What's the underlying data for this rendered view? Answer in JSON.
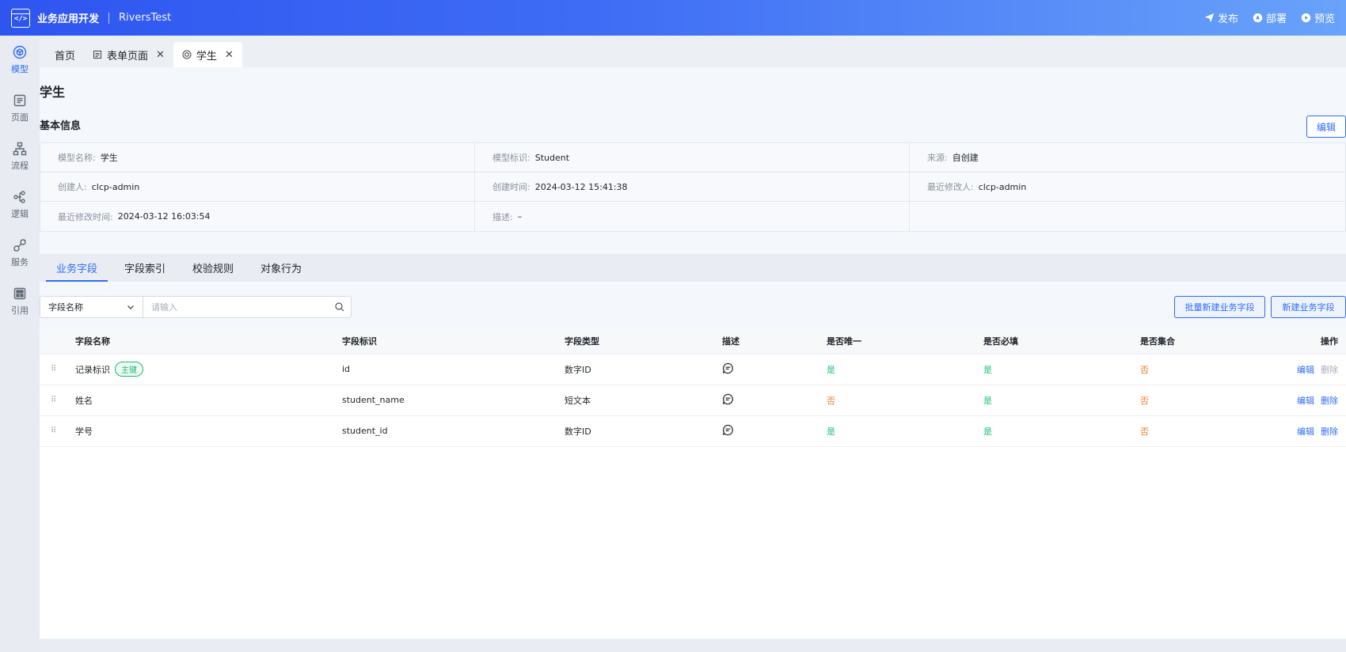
{
  "header": {
    "app_name": "业务应用开发",
    "project_name": "RiversTest",
    "actions": [
      {
        "label": "发布",
        "icon": "send-icon"
      },
      {
        "label": "部署",
        "icon": "deploy-icon"
      },
      {
        "label": "预览",
        "icon": "play-icon"
      }
    ]
  },
  "rail": [
    {
      "label": "模型",
      "icon": "model-icon",
      "active": true
    },
    {
      "label": "页面",
      "icon": "page-icon",
      "active": false
    },
    {
      "label": "流程",
      "icon": "flow-icon",
      "active": false
    },
    {
      "label": "逻辑",
      "icon": "logic-icon",
      "active": false
    },
    {
      "label": "服务",
      "icon": "service-icon",
      "active": false
    },
    {
      "label": "引用",
      "icon": "reference-icon",
      "active": false
    }
  ],
  "tabs": [
    {
      "label": "首页",
      "closable": false,
      "active": false
    },
    {
      "label": "表单页面",
      "closable": true,
      "active": false
    },
    {
      "label": "学生",
      "closable": true,
      "active": true
    }
  ],
  "page": {
    "title": "学生",
    "section_title": "基本信息",
    "edit_label": "编辑"
  },
  "info": [
    {
      "key": "模型名称:",
      "value": "学生"
    },
    {
      "key": "模型标识:",
      "value": "Student"
    },
    {
      "key": "来源:",
      "value": "自创建"
    },
    {
      "key": "创建人:",
      "value": "clcp-admin"
    },
    {
      "key": "创建时间:",
      "value": "2024-03-12 15:41:38"
    },
    {
      "key": "最近修改人:",
      "value": "clcp-admin"
    },
    {
      "key": "最近修改时间:",
      "value": "2024-03-12 16:03:54"
    },
    {
      "key": "描述:",
      "value": "–"
    },
    {
      "key": "",
      "value": ""
    }
  ],
  "subtabs": [
    "业务字段",
    "字段索引",
    "校验规则",
    "对象行为"
  ],
  "filter": {
    "select_value": "字段名称",
    "placeholder": "请输入"
  },
  "buttons": {
    "batch_new": "批量新建业务字段",
    "new": "新建业务字段"
  },
  "table": {
    "columns": [
      "字段名称",
      "字段标识",
      "字段类型",
      "描述",
      "是否唯一",
      "是否必填",
      "是否集合",
      "操作"
    ],
    "rows": [
      {
        "name": "记录标识",
        "badge": "主键",
        "ident": "id",
        "type": "数字ID",
        "unique": "是",
        "required": "是",
        "collection": "否",
        "edit": "编辑",
        "delete": "删除",
        "delete_disabled": true
      },
      {
        "name": "姓名",
        "badge": "",
        "ident": "student_name",
        "type": "短文本",
        "unique": "否",
        "required": "是",
        "collection": "否",
        "edit": "编辑",
        "delete": "删除",
        "delete_disabled": false
      },
      {
        "name": "学号",
        "badge": "",
        "ident": "student_id",
        "type": "数字ID",
        "unique": "是",
        "required": "是",
        "collection": "否",
        "edit": "编辑",
        "delete": "删除",
        "delete_disabled": false
      }
    ]
  },
  "colors": {
    "accent": "#2e6cf6",
    "yes": "#1fbf75",
    "no": "#f57b2a",
    "header_gradient_start": "#2e55f0",
    "header_gradient_end": "#69a3fa"
  }
}
